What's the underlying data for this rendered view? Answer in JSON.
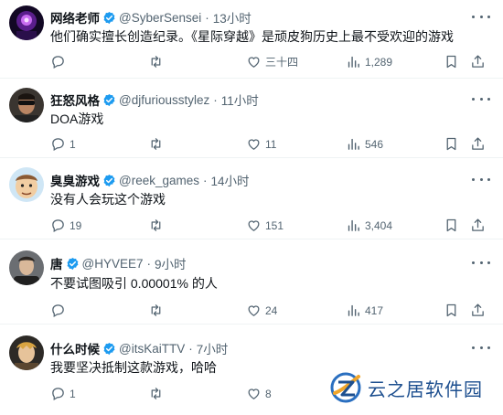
{
  "tweets": [
    {
      "name": "网络老师",
      "handle": "@SyberSensei",
      "time": "13小时",
      "text": "他们确实擅长创造纪录。《星际穿越》是顽皮狗历史上最不受欢迎的游戏",
      "replies": "",
      "retweets": "",
      "likes": "三十四",
      "views": "1,289",
      "avatar": "purple-glow-avatar"
    },
    {
      "name": "狂怒风格",
      "handle": "@djfuriousstylez",
      "time": "11小时",
      "text": "DOA游戏",
      "replies": "1",
      "retweets": "",
      "likes": "11",
      "views": "546",
      "avatar": "sunglasses-man-avatar"
    },
    {
      "name": "臭臭游戏",
      "handle": "@reek_games",
      "time": "14小时",
      "text": "没有人会玩这个游戏",
      "replies": "19",
      "retweets": "",
      "likes": "151",
      "views": "3,404",
      "avatar": "cartoon-face-avatar"
    },
    {
      "name": "唐",
      "handle": "@HYVEE7",
      "time": "9小时",
      "text": "不要试图吸引 0.00001% 的人",
      "replies": "",
      "retweets": "",
      "likes": "24",
      "views": "417",
      "avatar": "dark-portrait-avatar"
    },
    {
      "name": "什么时候",
      "handle": "@itsKaiTTV",
      "time": "7小时",
      "text": "我要坚决抵制这款游戏，哈哈",
      "replies": "1",
      "retweets": "",
      "likes": "8",
      "views": "",
      "avatar": "character-avatar"
    }
  ],
  "watermark": {
    "text": "云之居软件园"
  },
  "colors": {
    "verified": "#1d9bf0",
    "muted": "#536471",
    "text": "#0f1419",
    "divider": "#eff3f4"
  }
}
